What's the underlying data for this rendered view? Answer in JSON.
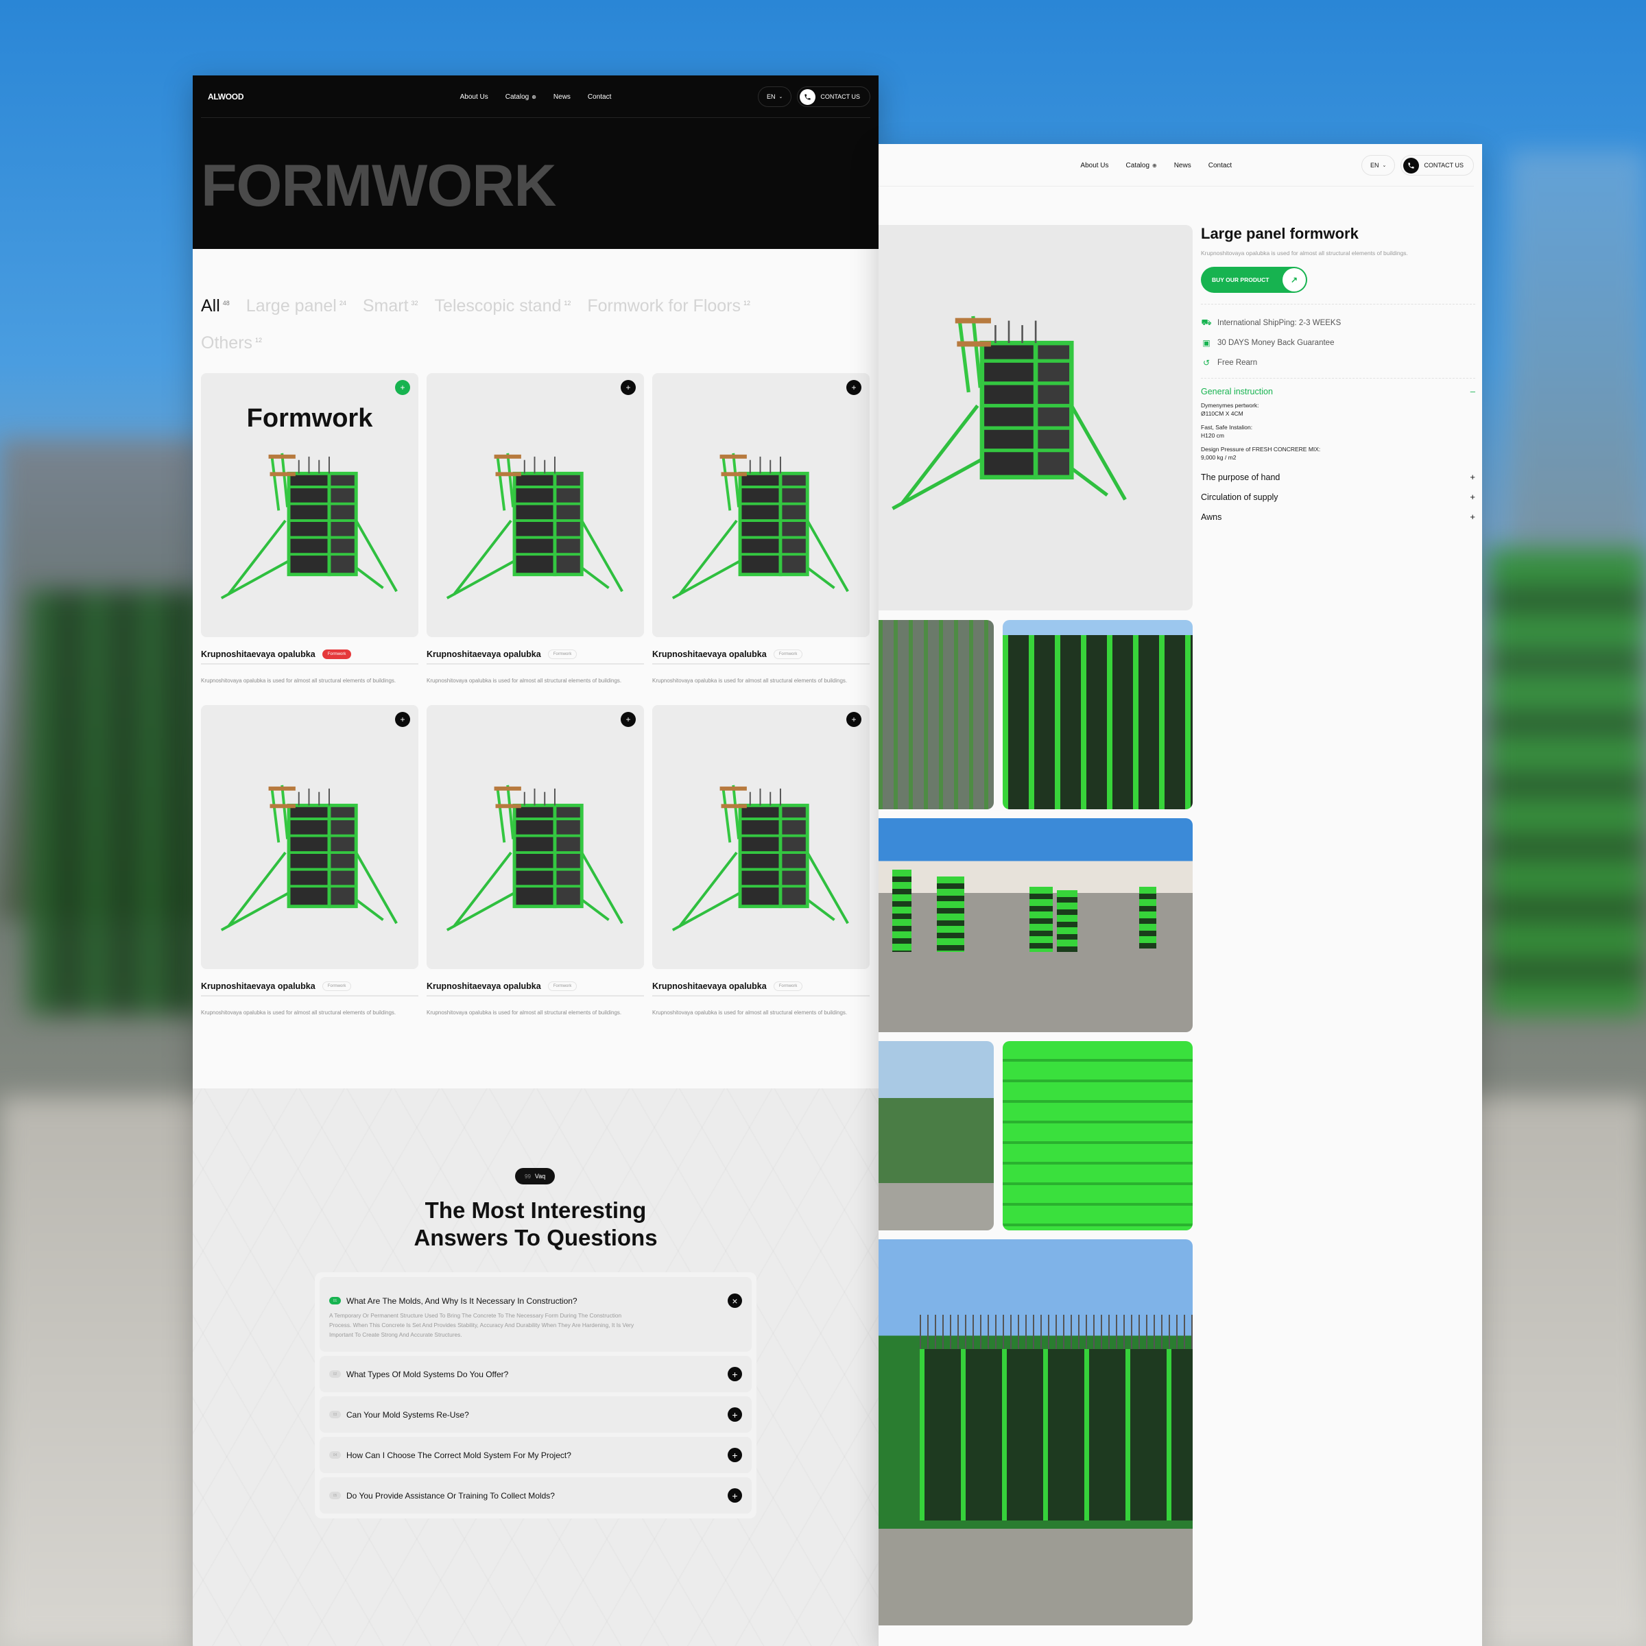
{
  "brand": {
    "logo_text": "ALWOOD",
    "accent_color": "#17b350",
    "badge_red": "#e5383b"
  },
  "nav": {
    "links": [
      "About Us",
      "Catalog",
      "News",
      "Contact"
    ],
    "catalog_icon": "plus-circle-icon",
    "language": "EN",
    "contact_label": "CONTACT US"
  },
  "catalog_page": {
    "hero_title": "FORMWORK",
    "filters": [
      {
        "label": "All",
        "count": "48",
        "active": true
      },
      {
        "label": "Large panel",
        "count": "24"
      },
      {
        "label": "Smart",
        "count": "32"
      },
      {
        "label": "Telescopic stand",
        "count": "12"
      },
      {
        "label": "Formwork for Floors",
        "count": "12"
      },
      {
        "label": "Others",
        "count": "12"
      }
    ],
    "featured_card_title": "Formwork",
    "products": [
      {
        "name": "Krupnoshitaevaya opalubka",
        "tag": "Formwork",
        "description": "Krupnoshitovaya opalubka is used for almost all structural elements of buildings."
      },
      {
        "name": "Krupnoshitaevaya opalubka",
        "tag": "Formwork",
        "description": "Krupnoshitovaya opalubka is used for almost all structural elements of buildings."
      },
      {
        "name": "Krupnoshitaevaya opalubka",
        "tag": "Formwork",
        "description": "Krupnoshitovaya opalubka is used for almost all structural elements of buildings."
      },
      {
        "name": "Krupnoshitaevaya opalubka",
        "tag": "Formwork",
        "description": "Krupnoshitovaya opalubka is used for almost all structural elements of buildings."
      },
      {
        "name": "Krupnoshitaevaya opalubka",
        "tag": "Formwork",
        "description": "Krupnoshitovaya opalubka is used for almost all structural elements of buildings."
      },
      {
        "name": "Krupnoshitaevaya opalubka",
        "tag": "Formwork",
        "description": "Krupnoshitovaya opalubka is used for almost all structural elements of buildings."
      }
    ],
    "faq": {
      "badge_quote": "99",
      "badge_label": "Vaq",
      "title_line1": "The Most Interesting",
      "title_line2": "Answers To Questions",
      "items": [
        {
          "num": "01",
          "question": "What Are The Molds, And Why Is It Necessary In Construction?",
          "answer": "A Temporary Or Permanent Structure Used To Bring The Concrete To The Necessary Form During The Construction Process. When This Concrete Is Set And Provides Stability, Accuracy And Durability When They Are Hardening, It Is Very Important To Create Strong And Accurate Structures.",
          "open": true
        },
        {
          "num": "02",
          "question": "What Types Of Mold Systems Do You Offer?"
        },
        {
          "num": "03",
          "question": "Can Your Mold Systems Re-Use?"
        },
        {
          "num": "04",
          "question": "How Can I Choose The Correct Mold System For My Project?"
        },
        {
          "num": "05",
          "question": "Do You Provide Assistance Or Training To Collect Molds?"
        }
      ]
    }
  },
  "product_page": {
    "title": "Large panel formwork",
    "subtitle": "Krupnoshitovaya opalubka is used for almost all structural elements of buildings.",
    "buy_label": "BUY OUR PRODUCT",
    "features": [
      {
        "icon": "truck-icon",
        "text": "International ShipPing: 2-3 WEEKS"
      },
      {
        "icon": "money-icon",
        "text": "30 DAYS Money Back Guarantee"
      },
      {
        "icon": "return-icon",
        "text": "Free Rearn"
      }
    ],
    "accordion": [
      {
        "title": "General instruction",
        "open": true,
        "specs": [
          {
            "label": "Dymenymes pertwork:",
            "value": "Ø110CM X 4CM"
          },
          {
            "label": "Fast, Safe Instalion:",
            "value": "H120 cm"
          },
          {
            "label": "Design Pressure of FRESH CONCRERE MIX:",
            "value": "9,000 kg / m2"
          }
        ]
      },
      {
        "title": "The purpose of hand"
      },
      {
        "title": "Circulation of supply"
      },
      {
        "title": "Awns"
      }
    ]
  }
}
